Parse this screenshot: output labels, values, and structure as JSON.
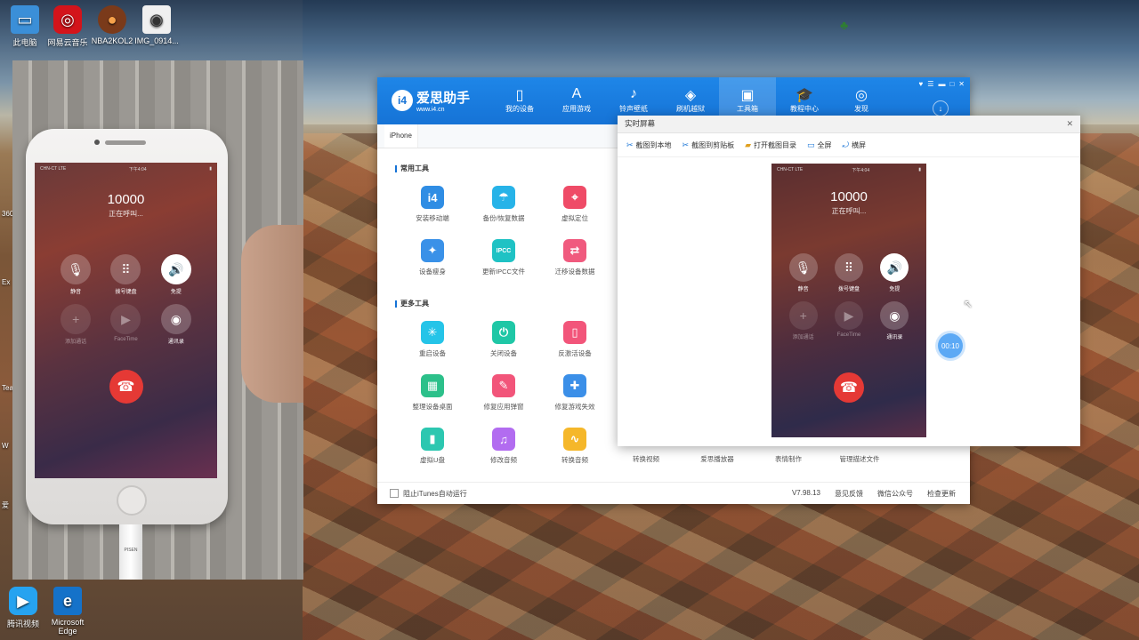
{
  "desktop_icons": [
    {
      "label": "此电脑",
      "icon": "computer-icon",
      "color": "#3b8fd8"
    },
    {
      "label": "网易云音乐",
      "icon": "netease-music-icon",
      "color": "#d3141b"
    },
    {
      "label": "NBA2KOL2",
      "icon": "basketball-icon",
      "color": "#7a3a1a"
    },
    {
      "label": "IMG_0914...",
      "icon": "image-file-icon",
      "color": "#f0f0f0"
    },
    {
      "label": "腾讯视频",
      "icon": "tencent-video-icon",
      "color": "#26a3f0"
    },
    {
      "label": "Microsoft Edge",
      "icon": "edge-icon",
      "color": "#1572c9"
    }
  ],
  "edge_labels": [
    "360",
    "Ex",
    "Tea",
    "W",
    "爱"
  ],
  "photo_phone": {
    "status_left": "CHN-CT LTE",
    "status_time": "下午4:04",
    "number": "10000",
    "status": "正在呼叫...",
    "buttons": [
      {
        "label": "静音",
        "icon": "mic-off-icon",
        "style": "normal"
      },
      {
        "label": "拨号键盘",
        "icon": "keypad-icon",
        "style": "normal"
      },
      {
        "label": "免提",
        "icon": "speaker-icon",
        "style": "white"
      },
      {
        "label": "添加通话",
        "icon": "plus-icon",
        "style": "dim"
      },
      {
        "label": "FaceTime",
        "icon": "facetime-icon",
        "style": "dim"
      },
      {
        "label": "通讯录",
        "icon": "contacts-icon",
        "style": "normal"
      }
    ],
    "cable_label": "PISEN"
  },
  "i4": {
    "logo_title": "爱思助手",
    "logo_url": "www.i4.cn",
    "nav": [
      {
        "label": "我的设备",
        "icon": "phone-icon"
      },
      {
        "label": "应用游戏",
        "icon": "appstore-icon"
      },
      {
        "label": "铃声壁纸",
        "icon": "ringtone-icon"
      },
      {
        "label": "刷机越狱",
        "icon": "jailbreak-icon"
      },
      {
        "label": "工具箱",
        "icon": "toolbox-icon",
        "active": true
      },
      {
        "label": "教程中心",
        "icon": "tutorial-icon"
      },
      {
        "label": "发现",
        "icon": "discover-icon"
      }
    ],
    "tab": "iPhone",
    "section_common": "常用工具",
    "common_tools": [
      {
        "label": "安装移动端",
        "color": "#2f8de4",
        "glyph": "i4"
      },
      {
        "label": "备份/恢复数据",
        "color": "#27b3e8",
        "glyph": "☂"
      },
      {
        "label": "虚拟定位",
        "color": "#ef4b67",
        "glyph": "⌖"
      },
      {
        "label": "设备瘦身",
        "color": "#3a91e8",
        "glyph": "✦"
      },
      {
        "label": "更新IPCC文件",
        "color": "#1fc2c4",
        "glyph": "IPCC"
      },
      {
        "label": "迁移设备数据",
        "color": "#f05a7e",
        "glyph": "⇄"
      }
    ],
    "section_more": "更多工具",
    "more_tools": [
      {
        "label": "重启设备",
        "color": "#25c4e8",
        "glyph": "✳"
      },
      {
        "label": "关闭设备",
        "color": "#1fc7a6",
        "glyph": "⏻"
      },
      {
        "label": "反激活设备",
        "color": "#f2557a",
        "glyph": "▯"
      },
      {
        "label": "整理设备桌面",
        "color": "#2cc08a",
        "glyph": "▦"
      },
      {
        "label": "修复应用弹窗",
        "color": "#f2557a",
        "glyph": "✎"
      },
      {
        "label": "修复游戏失效",
        "color": "#3b8fe8",
        "glyph": "🎮"
      },
      {
        "label": "虚拟U盘",
        "color": "#2cc7b0",
        "glyph": "▮"
      },
      {
        "label": "修改音频",
        "color": "#b26cf0",
        "glyph": "♫"
      },
      {
        "label": "转换音频",
        "color": "#f5b72a",
        "glyph": "∿"
      }
    ],
    "bottom_tools": [
      "转换视频",
      "爱思播放器",
      "表情制作",
      "管理描述文件"
    ],
    "status_checkbox": "阻止iTunes自动运行",
    "version": "V7.98.13",
    "feedback": "意见反馈",
    "wechat": "微信公众号",
    "update": "检查更新"
  },
  "rt": {
    "title": "实时屏幕",
    "toolbar": [
      {
        "label": "截图到本地",
        "icon": "scissors-icon"
      },
      {
        "label": "截图到剪贴板",
        "icon": "scissors-clipboard-icon"
      },
      {
        "label": "打开截图目录",
        "icon": "folder-icon"
      },
      {
        "label": "全屏",
        "icon": "fullscreen-icon"
      },
      {
        "label": "横屏",
        "icon": "landscape-icon"
      }
    ],
    "phone": {
      "status_left": "CHN-CT LTE",
      "status_time": "下午4:04",
      "number": "10000",
      "status": "正在呼叫...",
      "buttons": [
        {
          "label": "静音",
          "style": "normal"
        },
        {
          "label": "拨号键盘",
          "style": "normal"
        },
        {
          "label": "免提",
          "style": "white"
        },
        {
          "label": "添加通话",
          "style": "dim"
        },
        {
          "label": "FaceTime",
          "style": "dim"
        },
        {
          "label": "通讯录",
          "style": "normal"
        }
      ]
    }
  },
  "timer": "00:10"
}
